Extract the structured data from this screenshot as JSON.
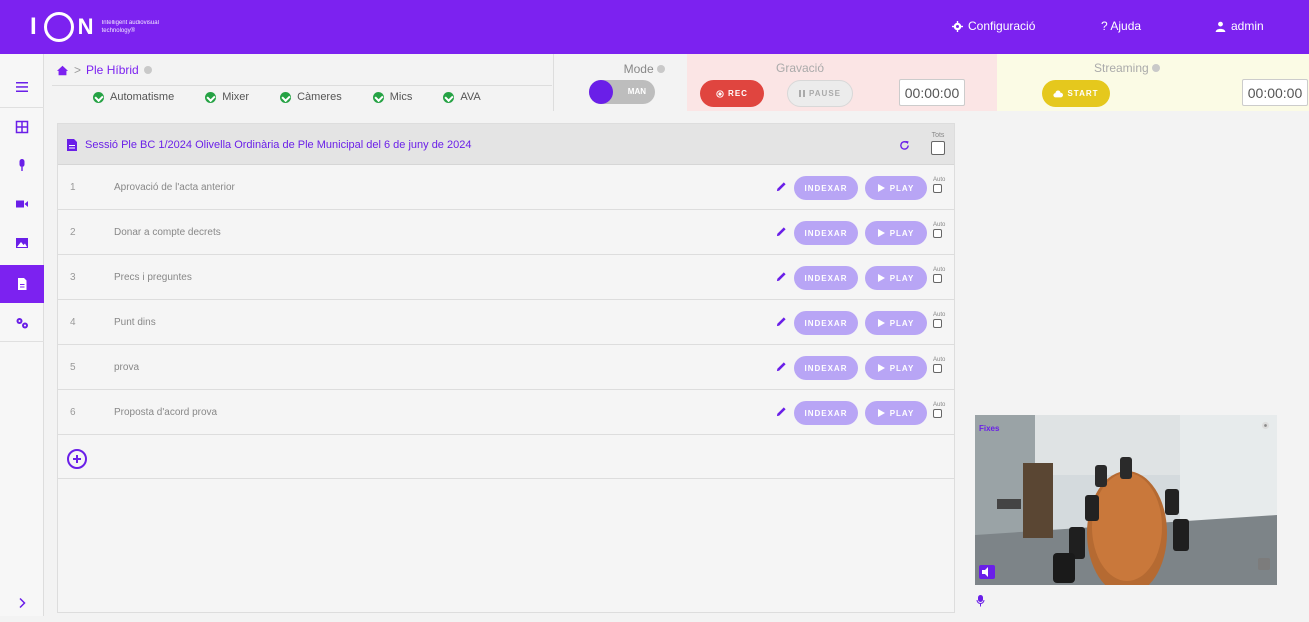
{
  "header": {
    "brand": "ION",
    "tagline": "Intelligent audiovisual technology®",
    "config": "Configuració",
    "help": "? Ajuda",
    "user": "admin"
  },
  "breadcrumb": {
    "title": "Ple Híbrid"
  },
  "status": [
    "Automatisme",
    "Mixer",
    "Càmeres",
    "Mics",
    "AVA"
  ],
  "mode": {
    "label": "Mode",
    "value": "MAN"
  },
  "recording": {
    "label": "Gravació",
    "rec": "REC",
    "pause": "PAUSE",
    "time": "00:00:00"
  },
  "streaming": {
    "label": "Streaming",
    "start": "START",
    "time": "00:00:00"
  },
  "session": {
    "title": "Sessió Ple BC 1/2024 Olivella Ordinària de Ple Municipal del 6 de juny de 2024",
    "all_label": "Tots"
  },
  "items": [
    {
      "num": "1",
      "title": "Aprovació de l'acta anterior"
    },
    {
      "num": "2",
      "title": "Donar a compte decrets"
    },
    {
      "num": "3",
      "title": "Precs i preguntes"
    },
    {
      "num": "4",
      "title": "Punt dins"
    },
    {
      "num": "5",
      "title": "prova"
    },
    {
      "num": "6",
      "title": "Proposta d'acord prova"
    }
  ],
  "item_buttons": {
    "index": "INDEXAR",
    "play": "PLAY",
    "auto": "Auto"
  },
  "camera": {
    "label": "Fixes"
  }
}
